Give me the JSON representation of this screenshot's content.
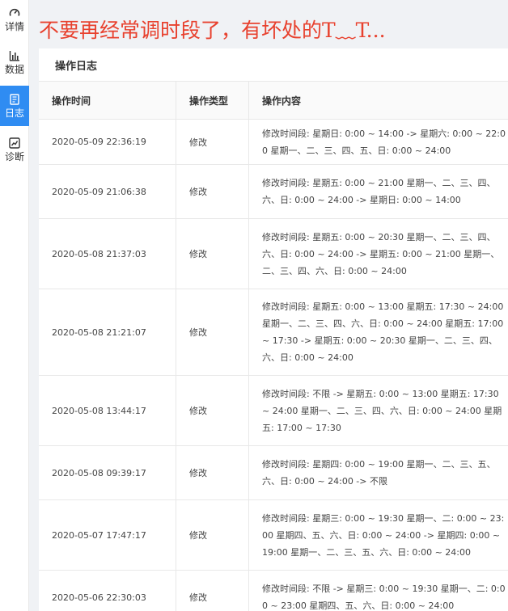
{
  "sidebar": {
    "items": [
      {
        "label": "详情",
        "icon": "gauge-icon",
        "active": false
      },
      {
        "label": "数据",
        "icon": "bar-chart-icon",
        "active": false
      },
      {
        "label": "日志",
        "icon": "document-icon",
        "active": true
      },
      {
        "label": "诊断",
        "icon": "trend-chart-icon",
        "active": false
      }
    ]
  },
  "banner": {
    "text": "不要再经常调时段了，有坏处的T﹏T..."
  },
  "panel": {
    "title": "操作日志"
  },
  "table": {
    "columns": [
      "操作时间",
      "操作类型",
      "操作内容"
    ],
    "rows": [
      {
        "time": "2020-05-09 22:36:19",
        "type": "修改",
        "content": "修改时间段: 星期日: 0:00 ~ 14:00 -> 星期六: 0:00 ~ 22:00 星期一、二、三、四、五、日: 0:00 ~ 24:00"
      },
      {
        "time": "2020-05-09 21:06:38",
        "type": "修改",
        "content": "修改时间段: 星期五: 0:00 ~ 21:00 星期一、二、三、四、六、日: 0:00 ~ 24:00 -> 星期日: 0:00 ~ 14:00"
      },
      {
        "time": "2020-05-08 21:37:03",
        "type": "修改",
        "content": "修改时间段: 星期五: 0:00 ~ 20:30 星期一、二、三、四、六、日: 0:00 ~ 24:00 -> 星期五: 0:00 ~ 21:00 星期一、二、三、四、六、日: 0:00 ~ 24:00"
      },
      {
        "time": "2020-05-08 21:21:07",
        "type": "修改",
        "content": "修改时间段: 星期五: 0:00 ~ 13:00 星期五: 17:30 ~ 24:00 星期一、二、三、四、六、日: 0:00 ~ 24:00 星期五: 17:00 ~ 17:30 -> 星期五: 0:00 ~ 20:30 星期一、二、三、四、六、日: 0:00 ~ 24:00"
      },
      {
        "time": "2020-05-08 13:44:17",
        "type": "修改",
        "content": "修改时间段: 不限 -> 星期五: 0:00 ~ 13:00 星期五: 17:30 ~ 24:00 星期一、二、三、四、六、日: 0:00 ~ 24:00 星期五: 17:00 ~ 17:30"
      },
      {
        "time": "2020-05-08 09:39:17",
        "type": "修改",
        "content": "修改时间段: 星期四: 0:00 ~ 19:00 星期一、二、三、五、六、日: 0:00 ~ 24:00 -> 不限"
      },
      {
        "time": "2020-05-07 17:47:17",
        "type": "修改",
        "content": "修改时间段: 星期三: 0:00 ~ 19:30 星期一、二: 0:00 ~ 23:00 星期四、五、六、日: 0:00 ~ 24:00 -> 星期四: 0:00 ~ 19:00 星期一、二、三、五、六、日: 0:00 ~ 24:00"
      },
      {
        "time": "2020-05-06 22:30:03",
        "type": "修改",
        "content": "修改时间段: 不限 -> 星期三: 0:00 ~ 19:30 星期一、二: 0:00 ~ 23:00 星期四、五、六、日: 0:00 ~ 24:00"
      }
    ]
  }
}
